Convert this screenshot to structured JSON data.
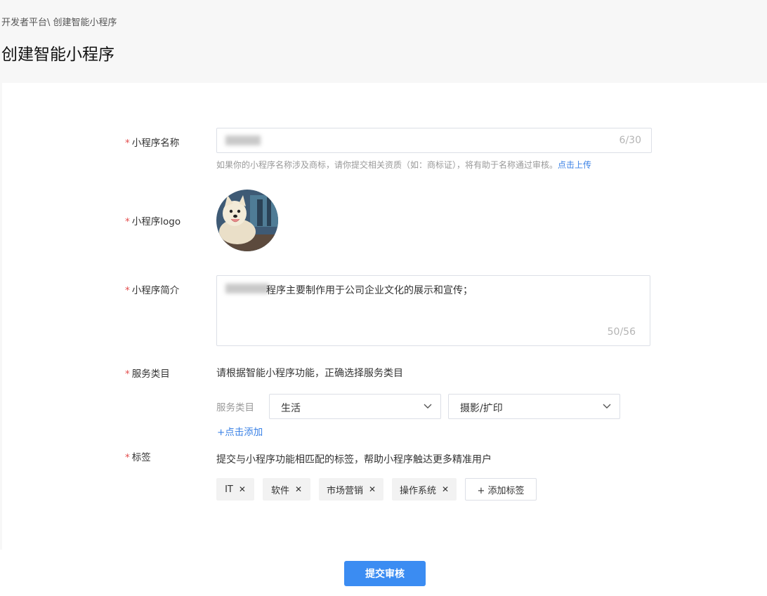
{
  "breadcrumb": "开发者平台\\ 创建智能小程序",
  "page_title": "创建智能小程序",
  "form": {
    "name": {
      "label": "小程序名称",
      "count": "6/30",
      "hint": "如果你的小程序名称涉及商标，请你提交相关资质（如：商标证），将有助于名称通过审核。",
      "hint_link": "点击上传"
    },
    "logo": {
      "label": "小程序logo"
    },
    "description": {
      "label": "小程序简介",
      "value": "程序主要制作用于公司企业文化的展示和宣传；",
      "count": "50/56"
    },
    "service": {
      "label": "服务类目",
      "instruction": "请根据智能小程序功能，正确选择服务类目",
      "row_label": "服务类目",
      "primary": "生活",
      "secondary": "摄影/扩印",
      "add_link": "+点击添加"
    },
    "tags": {
      "label": "标签",
      "instruction": "提交与小程序功能相匹配的标签，帮助小程序触达更多精准用户",
      "items": [
        "IT",
        "软件",
        "市场营销",
        "操作系统"
      ],
      "add_label": "+ 添加标签"
    }
  },
  "submit_label": "提交审核",
  "colors": {
    "accent": "#3b8cf2",
    "required": "#e34d4d",
    "link": "#3b82e6"
  }
}
